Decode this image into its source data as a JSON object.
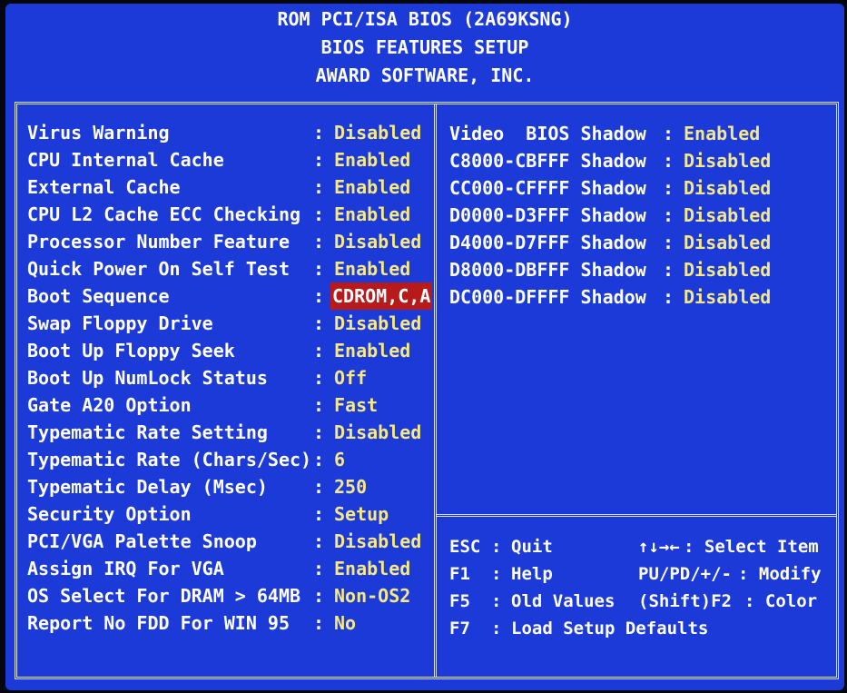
{
  "header": {
    "line1": "ROM PCI/ISA BIOS (2A69KSNG)",
    "line2": "BIOS FEATURES SETUP",
    "line3": "AWARD SOFTWARE, INC."
  },
  "left_settings": [
    {
      "label": "Virus Warning",
      "value": "Disabled"
    },
    {
      "label": "CPU Internal Cache",
      "value": "Enabled"
    },
    {
      "label": "External Cache",
      "value": "Enabled"
    },
    {
      "label": "CPU L2 Cache ECC Checking",
      "value": "Enabled"
    },
    {
      "label": "Processor Number Feature",
      "value": "Disabled"
    },
    {
      "label": "Quick Power On Self Test",
      "value": "Enabled"
    },
    {
      "label": "Boot Sequence",
      "value": "CDROM,C,A"
    },
    {
      "label": "Swap Floppy Drive",
      "value": "Disabled"
    },
    {
      "label": "Boot Up Floppy Seek",
      "value": "Enabled"
    },
    {
      "label": "Boot Up NumLock Status",
      "value": "Off"
    },
    {
      "label": "Gate A20 Option",
      "value": "Fast"
    },
    {
      "label": "Typematic Rate Setting",
      "value": "Disabled"
    },
    {
      "label": "Typematic Rate (Chars/Sec)",
      "value": "6"
    },
    {
      "label": "Typematic Delay (Msec)",
      "value": "250"
    },
    {
      "label": "Security Option",
      "value": "Setup"
    },
    {
      "label": "PCI/VGA Palette Snoop",
      "value": "Disabled"
    },
    {
      "label": "Assign IRQ For VGA",
      "value": "Enabled"
    },
    {
      "label": "OS Select For DRAM > 64MB",
      "value": "Non-OS2"
    },
    {
      "label": "Report No FDD For WIN 95",
      "value": "No"
    }
  ],
  "right_settings": [
    {
      "label": "Video  BIOS Shadow",
      "value": "Enabled"
    },
    {
      "label": "C8000-CBFFF Shadow",
      "value": "Disabled"
    },
    {
      "label": "CC000-CFFFF Shadow",
      "value": "Disabled"
    },
    {
      "label": "D0000-D3FFF Shadow",
      "value": "Disabled"
    },
    {
      "label": "D4000-D7FFF Shadow",
      "value": "Disabled"
    },
    {
      "label": "D8000-DBFFF Shadow",
      "value": "Disabled"
    },
    {
      "label": "DC000-DFFFF Shadow",
      "value": "Disabled"
    }
  ],
  "colon": ":",
  "help": {
    "esc_key": "ESC",
    "esc_text": "Quit",
    "arrows_key": "↑↓→←",
    "arrows_text": ": Select Item",
    "f1_key": "F1",
    "f1_text": "Help",
    "pu_key": "PU/PD/+/-",
    "pu_text": ": Modify",
    "f5_key": "F5",
    "f5_text": "Old Values",
    "shift_key": "(Shift)F2",
    "shift_text": ": Color",
    "f7_key": "F7",
    "f7_text": "Load Setup Defaults"
  },
  "colors": {
    "background": "#1c3ad8",
    "value": "#f5e888",
    "selected": "#b61a1a",
    "label": "#ffffff"
  }
}
